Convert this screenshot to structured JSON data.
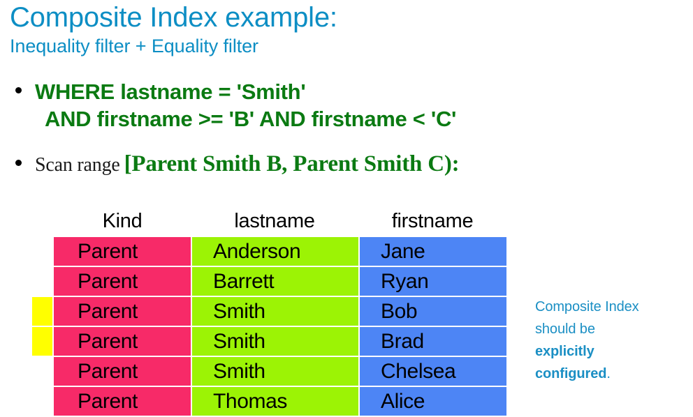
{
  "title": {
    "main": "Composite Index example:",
    "sub": "Inequality filter + Equality filter",
    "color": "#0d8ec4"
  },
  "bullets": {
    "query": {
      "line1": "WHERE lastname = 'Smith'",
      "line2": "AND firstname >= 'B' AND firstname < 'C'",
      "color": "#0b7a12"
    },
    "scan": {
      "label": "Scan range",
      "range": "[Parent Smith B, Parent Smith C):",
      "label_color": "#1a1a1a",
      "range_color": "#0b7a12"
    }
  },
  "table": {
    "headers": {
      "kind": "Kind",
      "lastname": "lastname",
      "firstname": "firstname"
    },
    "column_colors": {
      "kind": "#f72a68",
      "lastname": "#9cf305",
      "firstname": "#4d85f5"
    },
    "highlight_color": "#ffff00",
    "rows": [
      {
        "kind": "Parent",
        "lastname": "Anderson",
        "firstname": "Jane",
        "in_scan_range": false
      },
      {
        "kind": "Parent",
        "lastname": "Barrett",
        "firstname": "Ryan",
        "in_scan_range": false
      },
      {
        "kind": "Parent",
        "lastname": "Smith",
        "firstname": "Bob",
        "in_scan_range": true
      },
      {
        "kind": "Parent",
        "lastname": "Smith",
        "firstname": "Brad",
        "in_scan_range": true
      },
      {
        "kind": "Parent",
        "lastname": "Smith",
        "firstname": "Chelsea",
        "in_scan_range": false
      },
      {
        "kind": "Parent",
        "lastname": "Thomas",
        "firstname": "Alice",
        "in_scan_range": false
      }
    ]
  },
  "annotation": {
    "line1": "Composite Index",
    "line2": "should be",
    "line3_bold": "explicitly",
    "line4_bold": "configured",
    "line4_tail": ".",
    "color": "#1b8fc4"
  }
}
